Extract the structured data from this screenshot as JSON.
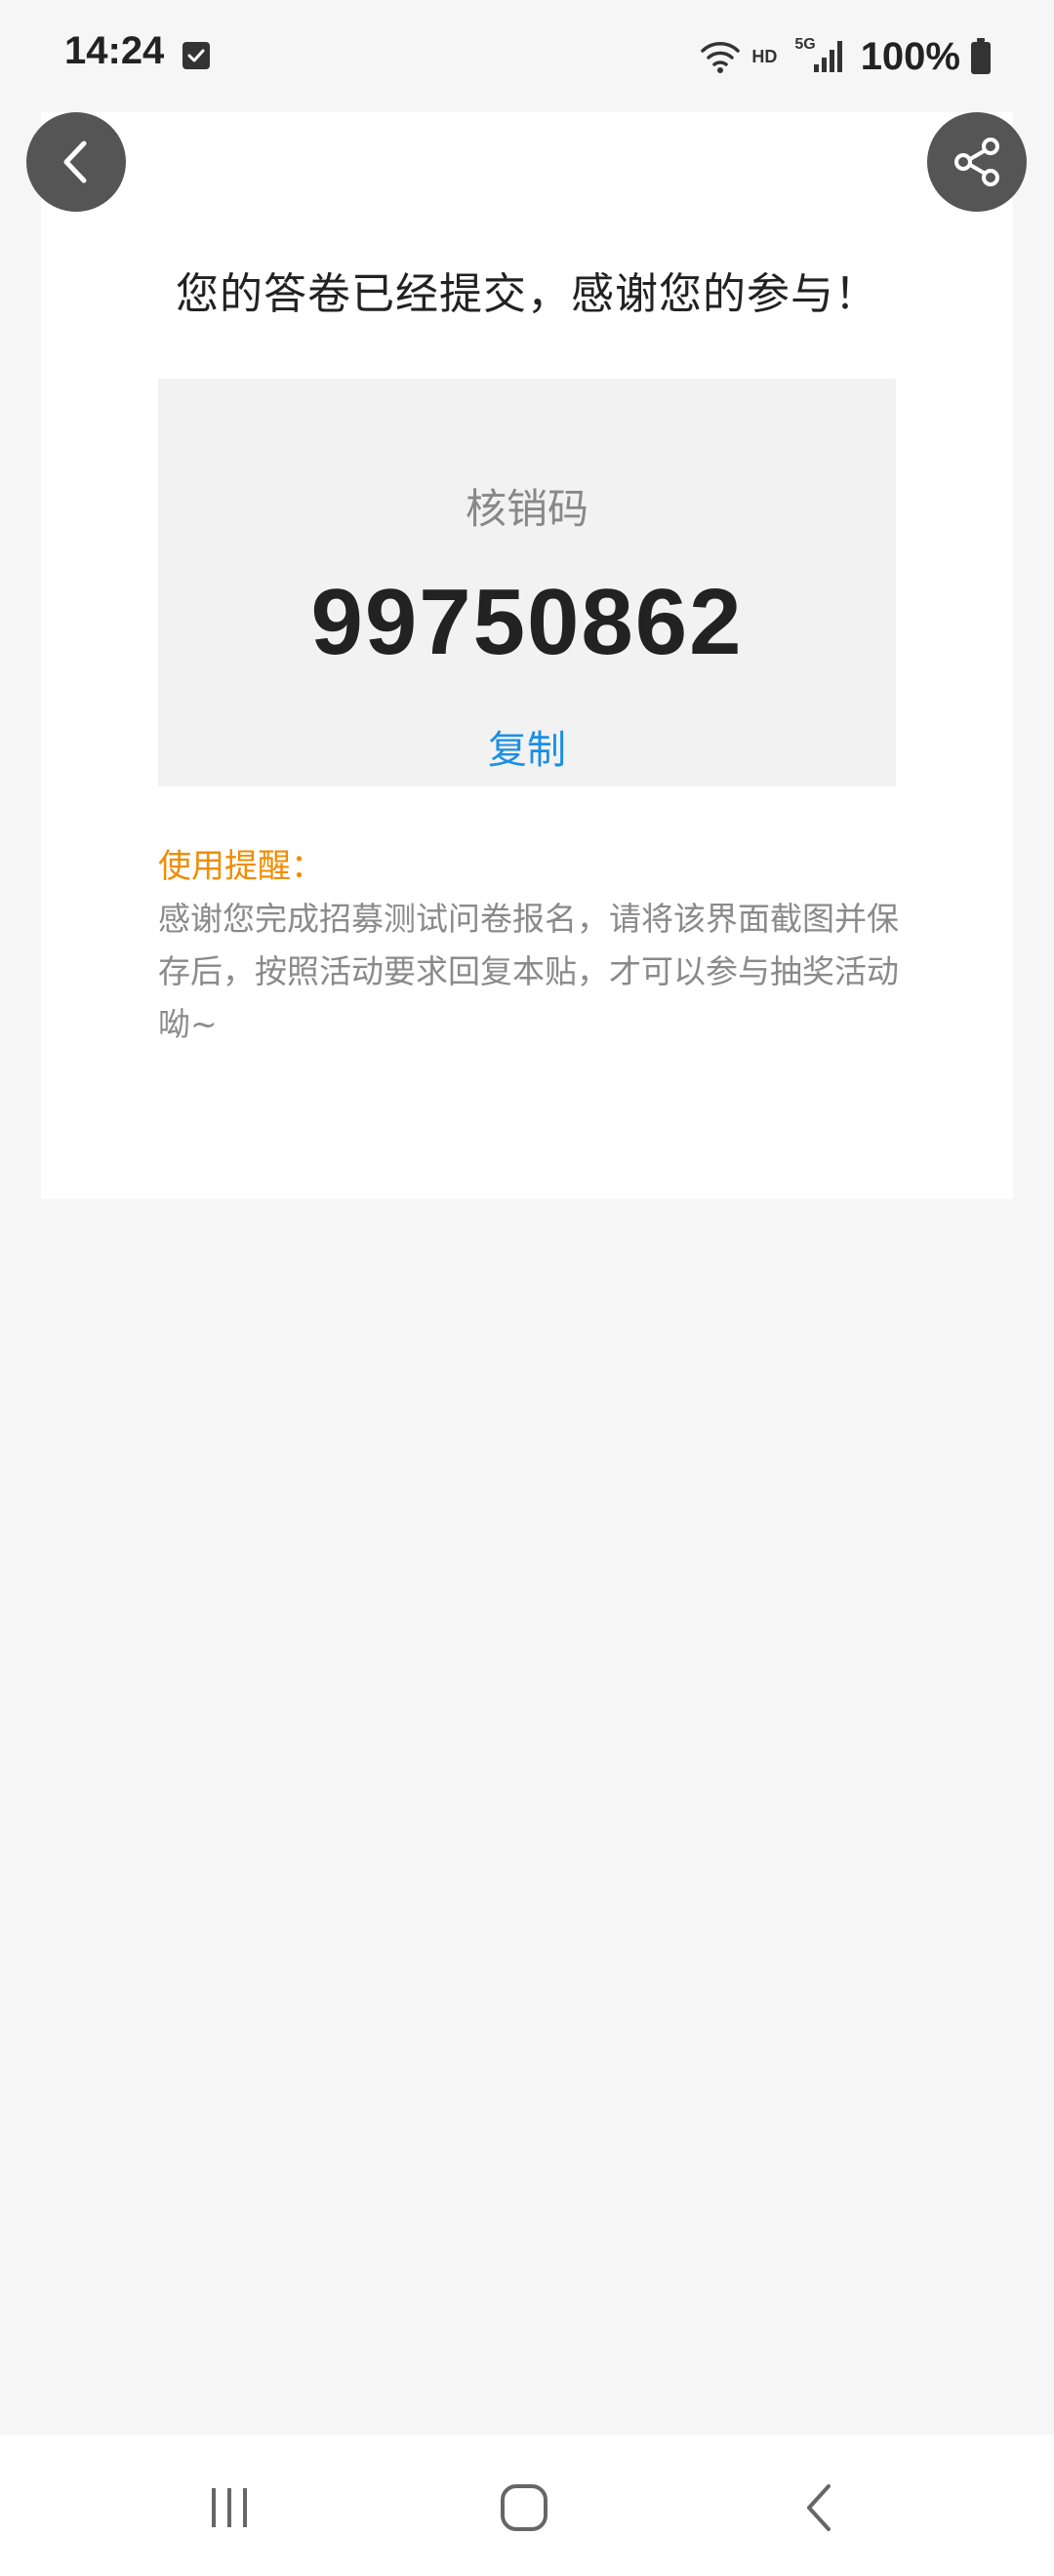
{
  "status_bar": {
    "time": "14:24",
    "hd": "HD",
    "network": "5G",
    "battery": "100%"
  },
  "result": {
    "headline": "您的答卷已经提交，感谢您的参与！",
    "code_label": "核销码",
    "code_value": "99750862",
    "copy_label": "复制"
  },
  "tips": {
    "title": "使用提醒：",
    "body": "感谢您完成招募测试问卷报名，请将该界面截图并保存后，按照活动要求回复本贴，才可以参与抽奖活动呦~"
  },
  "colors": {
    "accent_blue": "#1a8fe6",
    "tip_orange": "#f08c00",
    "button_gray": "#555555"
  },
  "icons": {
    "back": "chevron-left-icon",
    "share": "share-icon",
    "nav_recent": "recent-apps-icon",
    "nav_home": "home-icon",
    "nav_back": "nav-back-icon"
  }
}
